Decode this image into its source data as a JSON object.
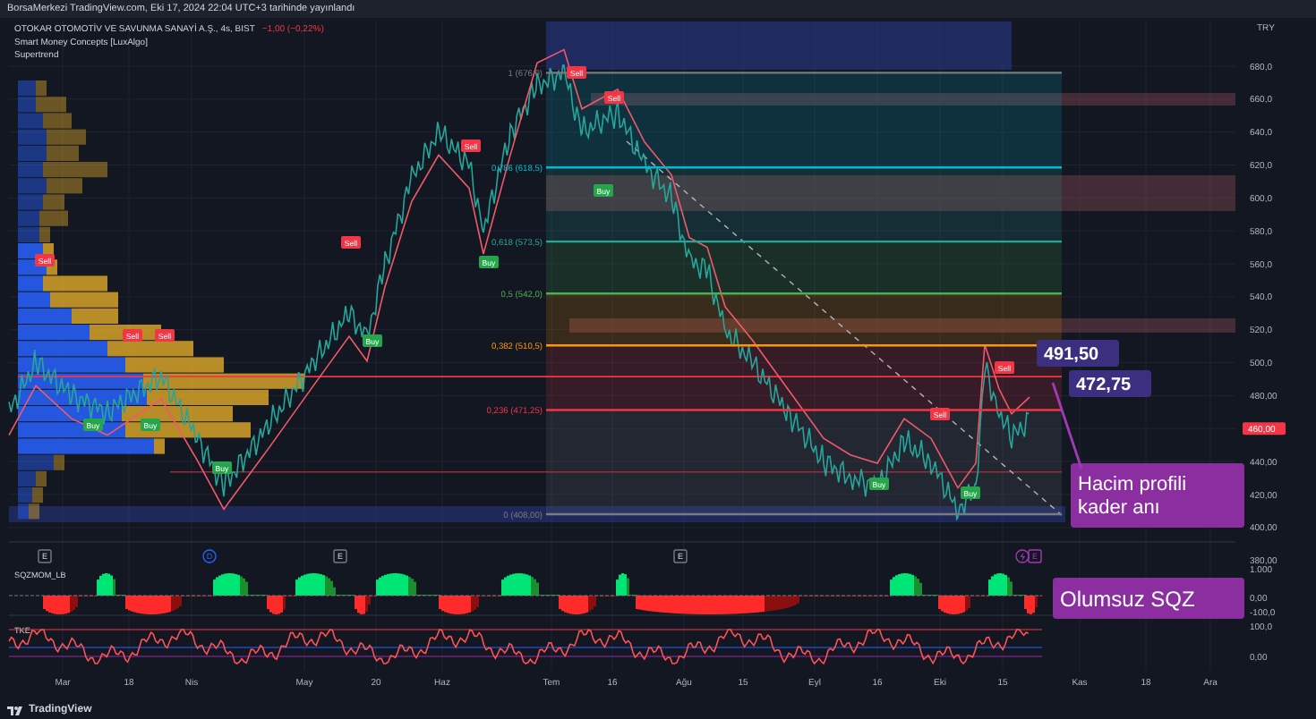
{
  "header": {
    "text": "BorsaMerkezi TradingView.com, Eki 17, 2024 22:04 UTC+3 tarihinde yayınlandı"
  },
  "legend": {
    "symbol": "OTOKAR OTOMOTİV VE SAVUNMA SANAYİ A.Ş., 4s, BIST",
    "change": "−1,00 (−0,22%)",
    "indicators": [
      "Smart Money Concepts [LuxAlgo]",
      "Supertrend"
    ]
  },
  "currency": "TRY",
  "price_axis": [
    "680,0",
    "660,0",
    "640,0",
    "620,0",
    "600,0",
    "580,0",
    "560,0",
    "540,0",
    "520,0",
    "500,0",
    "480,00",
    "440,00",
    "420,00",
    "400,00",
    "380,00"
  ],
  "current_price": "460,00",
  "fib_levels": [
    {
      "label": "1 (676,0)",
      "color": "#787b86"
    },
    {
      "label": "0,786 (618,5)",
      "color": "#00bcd4"
    },
    {
      "label": "0,618 (573,5)",
      "color": "#26a69a"
    },
    {
      "label": "0,5 (542,0)",
      "color": "#4caf50"
    },
    {
      "label": "0,382 (510,5)",
      "color": "#ff9800"
    },
    {
      "label": "0,236 (471,25)",
      "color": "#f23645"
    },
    {
      "label": "0 (408,00)",
      "color": "#787b86"
    }
  ],
  "markers": [
    {
      "kind": "sell",
      "label": "Sell"
    },
    {
      "kind": "sell",
      "label": "Sell"
    },
    {
      "kind": "sell",
      "label": "Sell"
    },
    {
      "kind": "sell",
      "label": "Sell"
    },
    {
      "kind": "sell",
      "label": "Sell"
    },
    {
      "kind": "buy",
      "label": "Buy"
    },
    {
      "kind": "buy",
      "label": "Buy"
    },
    {
      "kind": "buy",
      "label": "Buy"
    },
    {
      "kind": "buy",
      "label": "Buy"
    },
    {
      "kind": "buy",
      "label": "Buy"
    },
    {
      "kind": "sell",
      "label": "Sell"
    },
    {
      "kind": "sell",
      "label": "Sell"
    },
    {
      "kind": "buy",
      "label": "Buy"
    },
    {
      "kind": "sell",
      "label": "Sell"
    },
    {
      "kind": "sell",
      "label": "Sell"
    },
    {
      "kind": "buy",
      "label": "Buy"
    },
    {
      "kind": "buy",
      "label": "Buy"
    }
  ],
  "callouts": [
    {
      "kind": "price",
      "text": "491,50"
    },
    {
      "kind": "price",
      "text": "472,75"
    },
    {
      "kind": "note",
      "text": "Hacim profili kader anı"
    },
    {
      "kind": "note",
      "text": "Olumsuz SQZ"
    }
  ],
  "events": [
    {
      "kind": "earnings",
      "label": "E"
    },
    {
      "kind": "dividend",
      "label": "D"
    },
    {
      "kind": "earnings",
      "label": "E"
    },
    {
      "kind": "earnings",
      "label": "E"
    },
    {
      "kind": "upcoming",
      "label": "E"
    }
  ],
  "panes": [
    {
      "name": "SQZMOM_LB",
      "axis": [
        "1.000",
        "0,00",
        "-100,0"
      ]
    },
    {
      "name": "TKE",
      "axis": [
        "100,0",
        "0,00"
      ]
    }
  ],
  "time_axis": [
    "Mar",
    "18",
    "Nis",
    "May",
    "20",
    "Haz",
    "Tem",
    "16",
    "Ağu",
    "15",
    "Eyl",
    "16",
    "Eki",
    "15",
    "Kas",
    "18",
    "Ara"
  ],
  "footer": {
    "brand": "TradingView"
  }
}
